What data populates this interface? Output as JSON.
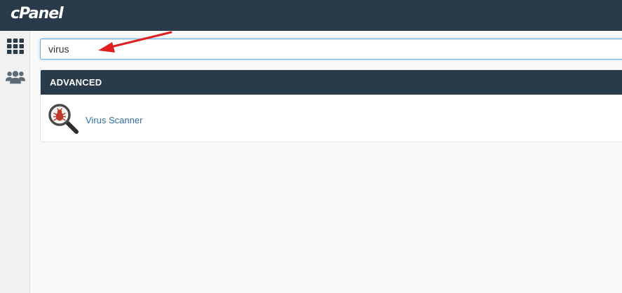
{
  "header": {
    "logo_text": "cPanel",
    "background": "#293a4a"
  },
  "sidebar": {
    "items": [
      {
        "icon": "grid-icon",
        "label": ""
      },
      {
        "icon": "users-icon",
        "label": ""
      }
    ]
  },
  "search": {
    "value": "virus",
    "placeholder": ""
  },
  "results": {
    "groups": [
      {
        "title": "ADVANCED",
        "items": [
          {
            "label": "Virus Scanner",
            "icon": "virus-scanner-icon"
          }
        ]
      }
    ]
  },
  "annotation": {
    "color": "#e02020"
  }
}
